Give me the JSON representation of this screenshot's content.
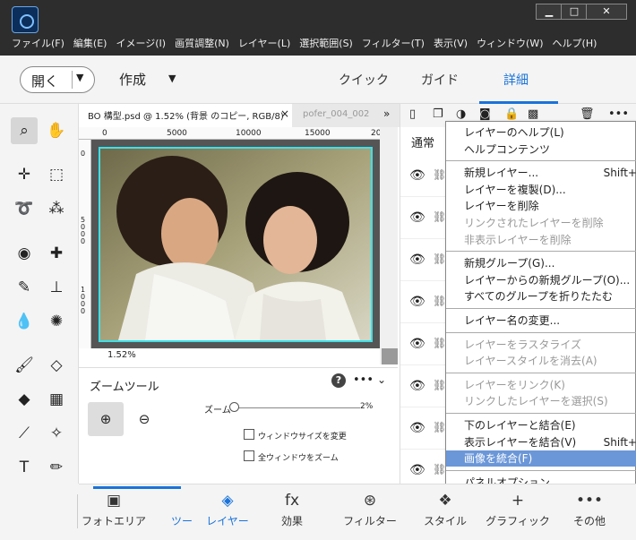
{
  "menubar": [
    "ファイル(F)",
    "編集(E)",
    "イメージ(I)",
    "画質調整(N)",
    "レイヤー(L)",
    "選択範囲(S)",
    "フィルター(T)",
    "表示(V)",
    "ウィンドウ(W)",
    "ヘルプ(H)"
  ],
  "window_controls": {
    "minimize": "▁",
    "maximize": "□",
    "close": "✕"
  },
  "modebar": {
    "open": "開く",
    "create": "作成",
    "tabs": [
      "クイック",
      "ガイド",
      "詳細"
    ],
    "active_tab": "詳細"
  },
  "document": {
    "active_tab": "BO 構型.psd @ 1.52% (背景 のコピー, RGB/8)",
    "second_tab": "pofer_004_002",
    "ruler_top": [
      "0",
      "5000",
      "10000",
      "15000",
      "20"
    ],
    "ruler_left": [
      "0",
      "5000",
      "1000"
    ],
    "zoom_readout": "1.52%"
  },
  "tool_options": {
    "title": "ズームツール",
    "zoom_label": "ズーム",
    "zoom_value": "2%",
    "zoom_fraction": 0.0,
    "resize_windows": "ウィンドウサイズを変更",
    "zoom_all_windows": "全ウィンドウをズーム"
  },
  "layers": {
    "blend_mode": "通常"
  },
  "context_menu": {
    "items": [
      {
        "label": "レイヤーのヘルプ(L)",
        "disabled": false
      },
      {
        "label": "ヘルプコンテンツ",
        "disabled": false
      },
      {
        "sep": true
      },
      {
        "label": "新規レイヤー...",
        "shortcut": "Shift+",
        "disabled": false
      },
      {
        "label": "レイヤーを複製(D)...",
        "disabled": false
      },
      {
        "label": "レイヤーを削除",
        "disabled": false
      },
      {
        "label": "リンクされたレイヤーを削除",
        "disabled": true
      },
      {
        "label": "非表示レイヤーを削除",
        "disabled": true
      },
      {
        "sep": true
      },
      {
        "label": "新規グループ(G)...",
        "disabled": false
      },
      {
        "label": "レイヤーからの新規グループ(O)...",
        "disabled": false
      },
      {
        "label": "すべてのグループを折りたたむ",
        "disabled": false
      },
      {
        "sep": true
      },
      {
        "label": "レイヤー名の変更...",
        "disabled": false
      },
      {
        "sep": true
      },
      {
        "label": "レイヤーをラスタライズ",
        "disabled": true
      },
      {
        "label": "レイヤースタイルを消去(A)",
        "disabled": true
      },
      {
        "sep": true
      },
      {
        "label": "レイヤーをリンク(K)",
        "disabled": true
      },
      {
        "label": "リンクしたレイヤーを選択(S)",
        "disabled": true
      },
      {
        "sep": true
      },
      {
        "label": "下のレイヤーと結合(E)",
        "disabled": false
      },
      {
        "label": "表示レイヤーを結合(V)",
        "shortcut": "Shift+",
        "disabled": false
      },
      {
        "label": "画像を統合(F)",
        "disabled": false,
        "highlight": true
      },
      {
        "sep": true
      },
      {
        "label": "パネルオプション...",
        "disabled": false
      }
    ]
  },
  "bottombar": [
    {
      "label": "フォトエリア",
      "icon": "photo-bin-icon",
      "glyph": "▣"
    },
    {
      "label": "ツー",
      "icon": "tool-options-icon",
      "glyph": "",
      "active": true
    },
    {
      "label": "レイヤー",
      "icon": "layers-icon",
      "glyph": "◈",
      "active": true
    },
    {
      "label": "効果",
      "icon": "fx-icon",
      "glyph": "fx"
    },
    {
      "label": "フィルター",
      "icon": "filter-icon",
      "glyph": "⊛"
    },
    {
      "label": "スタイル",
      "icon": "styles-icon",
      "glyph": "❖"
    },
    {
      "label": "グラフィック",
      "icon": "graphics-icon",
      "glyph": "+"
    },
    {
      "label": "その他",
      "icon": "more-icon",
      "glyph": "•••"
    }
  ],
  "colors": {
    "accent": "#1a73d9",
    "selection": "#3ce0e8",
    "menu_highlight": "#6b97d8"
  }
}
